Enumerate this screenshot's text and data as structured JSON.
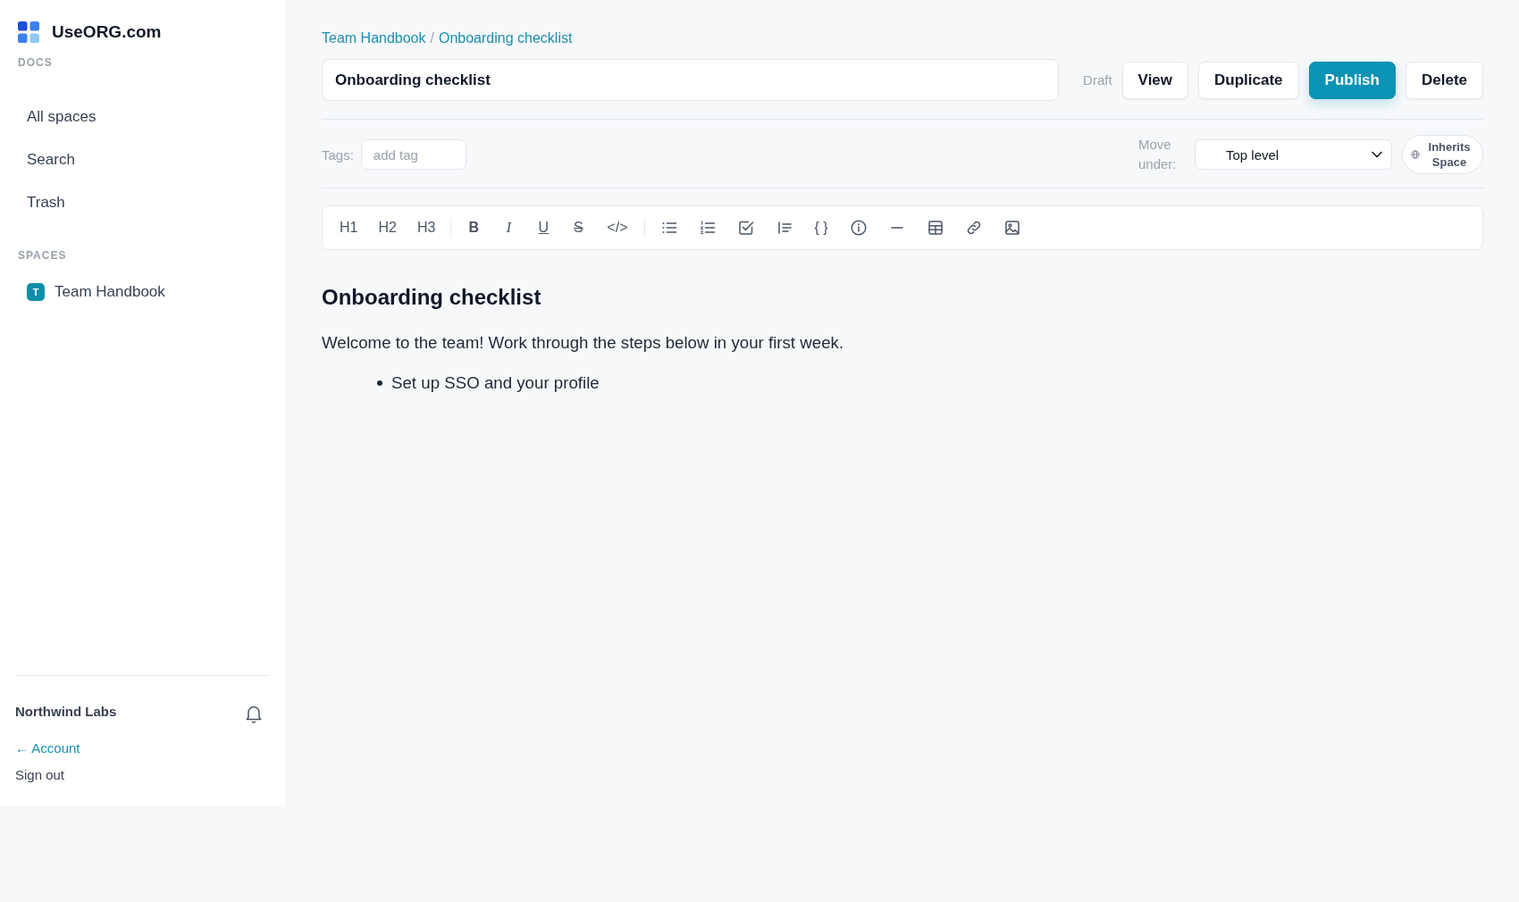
{
  "sidebar": {
    "brand": "UseORG.com",
    "docs_label": "DOCS",
    "nav": [
      {
        "label": "All spaces",
        "selected": false
      },
      {
        "label": "Search",
        "selected": false
      },
      {
        "label": "Trash",
        "selected": false
      }
    ],
    "spaces_label": "SPACES",
    "spaces": [
      {
        "initial": "T",
        "name": "Team Handbook",
        "color": "#0b8fab",
        "selected": false
      }
    ],
    "org": "Northwind Labs",
    "links": [
      {
        "kind": "account",
        "label": "← Account"
      },
      {
        "kind": "signout",
        "label": "Sign out"
      }
    ]
  },
  "breadcrumb": {
    "items": [
      "Team Handbook",
      "Onboarding checklist"
    ],
    "separator": "/"
  },
  "title": {
    "value": "Onboarding checklist"
  },
  "status": "Draft",
  "actions": [
    {
      "label": "View",
      "kind": "default"
    },
    {
      "label": "Duplicate",
      "kind": "default"
    },
    {
      "label": "Publish",
      "kind": "primary"
    },
    {
      "label": "Delete",
      "kind": "default"
    }
  ],
  "tags": {
    "label": "Tags:",
    "placeholder": "add tag"
  },
  "move": {
    "label": "Move under:",
    "value": "Top level"
  },
  "visibility": {
    "label": "Inherits Space"
  },
  "toolbar": {
    "groups": [
      {
        "items": [
          {
            "kind": "heading",
            "label": "H1"
          },
          {
            "kind": "heading",
            "label": "H2"
          },
          {
            "kind": "heading",
            "label": "H3"
          }
        ]
      },
      {
        "items": [
          {
            "kind": "bold",
            "label": "B"
          },
          {
            "kind": "italic",
            "label": "I"
          },
          {
            "kind": "underline",
            "label": "U"
          },
          {
            "kind": "strike",
            "label": "S"
          },
          {
            "kind": "code",
            "label": "</>"
          }
        ]
      },
      {
        "items": [
          {
            "kind": "bullets"
          },
          {
            "kind": "numbers"
          },
          {
            "kind": "checklist"
          },
          {
            "kind": "quote"
          },
          {
            "kind": "codeblock",
            "label": "{ }"
          },
          {
            "kind": "info"
          },
          {
            "kind": "rule"
          },
          {
            "kind": "table"
          },
          {
            "kind": "link"
          },
          {
            "kind": "image"
          }
        ]
      }
    ]
  },
  "document": {
    "blocks": [
      {
        "kind": "heading",
        "text": "Onboarding checklist"
      },
      {
        "kind": "paragraph",
        "text": "Welcome to the team! Work through the steps below in your first week."
      },
      {
        "kind": "bullets",
        "items": [
          "Set up SSO and your profile"
        ]
      }
    ]
  }
}
